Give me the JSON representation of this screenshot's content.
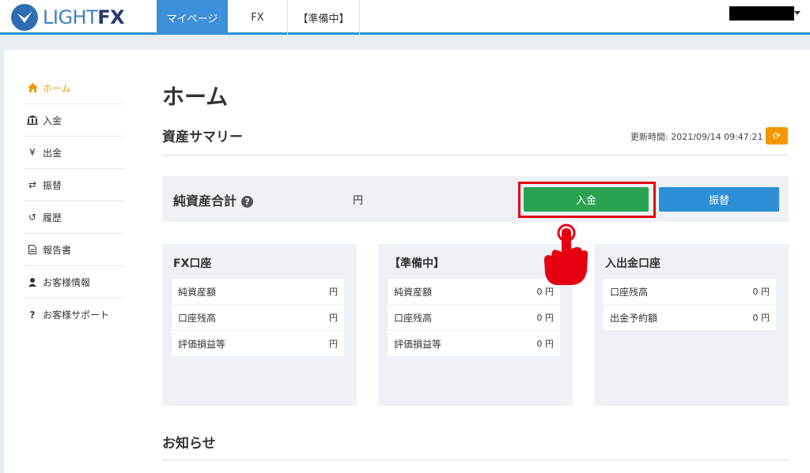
{
  "brand": {
    "logo_light": "LIGHT",
    "logo_fx": "FX"
  },
  "nav": {
    "items": [
      {
        "label": "マイページ"
      },
      {
        "label": "FX"
      },
      {
        "label": "【準備中】"
      }
    ]
  },
  "sidebar": {
    "items": [
      {
        "label": "ホーム",
        "icon": "home-icon"
      },
      {
        "label": "入金",
        "icon": "bank-icon"
      },
      {
        "label": "出金",
        "icon": "yen-icon"
      },
      {
        "label": "振替",
        "icon": "transfer-icon"
      },
      {
        "label": "履歴",
        "icon": "history-icon"
      },
      {
        "label": "報告書",
        "icon": "document-icon"
      },
      {
        "label": "お客様情報",
        "icon": "user-icon"
      },
      {
        "label": "お客様サポート",
        "icon": "question-icon"
      }
    ]
  },
  "main": {
    "title": "ホーム",
    "summary_title": "資産サマリー",
    "updated_label": "更新時間: 2021/09/14 09:47:21",
    "net_assets_label": "純資産合計",
    "net_assets_unit": "円",
    "deposit_button": "入金",
    "transfer_button": "振替",
    "news_title": "お知らせ"
  },
  "cards": [
    {
      "title": "FX口座",
      "rows": [
        {
          "label": "純資産額",
          "value": "円"
        },
        {
          "label": "口座残高",
          "value": "円"
        },
        {
          "label": "評価損益等",
          "value": "円"
        }
      ]
    },
    {
      "title": "【準備中】",
      "rows": [
        {
          "label": "純資産額",
          "value": "0 円"
        },
        {
          "label": "口座残高",
          "value": "0 円"
        },
        {
          "label": "評価損益等",
          "value": "0 円"
        }
      ]
    },
    {
      "title": "入出金口座",
      "rows": [
        {
          "label": "口座残高",
          "value": "0 円"
        },
        {
          "label": "出金予約額",
          "value": "0 円"
        }
      ]
    }
  ],
  "colors": {
    "accent_blue": "#2d8fd6",
    "deposit_green": "#2aa251",
    "orange": "#f39800",
    "highlight_red": "#e60012"
  }
}
